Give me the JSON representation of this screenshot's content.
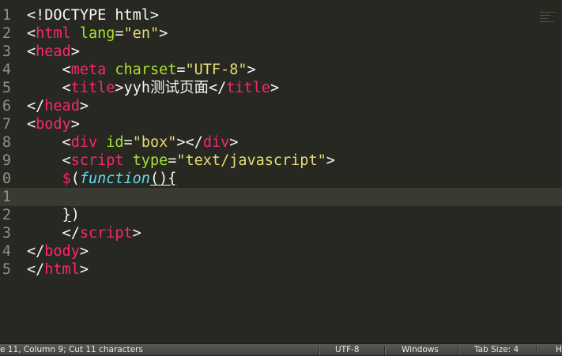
{
  "editor": {
    "line_numbers": [
      "1",
      "2",
      "3",
      "4",
      "5",
      "6",
      "7",
      "8",
      "9",
      "0",
      "1",
      "2",
      "3",
      "4",
      "5"
    ],
    "lines": [
      [
        {
          "t": "<!DOCTYPE html>",
          "c": "plain"
        }
      ],
      [
        {
          "t": "<",
          "c": "plain"
        },
        {
          "t": "html",
          "c": "tag"
        },
        {
          "t": " ",
          "c": "plain"
        },
        {
          "t": "lang",
          "c": "attr"
        },
        {
          "t": "=",
          "c": "plain"
        },
        {
          "t": "\"en\"",
          "c": "str"
        },
        {
          "t": ">",
          "c": "plain"
        }
      ],
      [
        {
          "t": "<",
          "c": "plain"
        },
        {
          "t": "head",
          "c": "tag"
        },
        {
          "t": ">",
          "c": "plain"
        }
      ],
      [
        {
          "t": "    <",
          "c": "plain"
        },
        {
          "t": "meta",
          "c": "tag"
        },
        {
          "t": " ",
          "c": "plain"
        },
        {
          "t": "charset",
          "c": "attr"
        },
        {
          "t": "=",
          "c": "plain"
        },
        {
          "t": "\"UTF-8\"",
          "c": "str"
        },
        {
          "t": ">",
          "c": "plain"
        }
      ],
      [
        {
          "t": "    <",
          "c": "plain"
        },
        {
          "t": "title",
          "c": "tag"
        },
        {
          "t": ">yyh测试页面</",
          "c": "plain"
        },
        {
          "t": "title",
          "c": "tag"
        },
        {
          "t": ">",
          "c": "plain"
        }
      ],
      [
        {
          "t": "</",
          "c": "plain"
        },
        {
          "t": "head",
          "c": "tag"
        },
        {
          "t": ">",
          "c": "plain"
        }
      ],
      [
        {
          "t": "<",
          "c": "plain"
        },
        {
          "t": "body",
          "c": "tag"
        },
        {
          "t": ">",
          "c": "plain"
        }
      ],
      [
        {
          "t": "    <",
          "c": "plain"
        },
        {
          "t": "div",
          "c": "tag"
        },
        {
          "t": " ",
          "c": "plain"
        },
        {
          "t": "id",
          "c": "attr"
        },
        {
          "t": "=",
          "c": "plain"
        },
        {
          "t": "\"box\"",
          "c": "str"
        },
        {
          "t": "></",
          "c": "plain"
        },
        {
          "t": "div",
          "c": "tag"
        },
        {
          "t": ">",
          "c": "plain"
        }
      ],
      [
        {
          "t": "    <",
          "c": "plain"
        },
        {
          "t": "script",
          "c": "tag"
        },
        {
          "t": " ",
          "c": "plain"
        },
        {
          "t": "type",
          "c": "attr"
        },
        {
          "t": "=",
          "c": "plain"
        },
        {
          "t": "\"text/javascript\"",
          "c": "str"
        },
        {
          "t": ">",
          "c": "plain"
        }
      ],
      [
        {
          "t": "    ",
          "c": "plain"
        },
        {
          "t": "$",
          "c": "tag"
        },
        {
          "t": "(",
          "c": "plain"
        },
        {
          "t": "function",
          "c": "kw"
        },
        {
          "t": "(){",
          "c": "plain",
          "u": true
        }
      ],
      [],
      [
        {
          "t": "    ",
          "c": "plain"
        },
        {
          "t": "}",
          "c": "plain",
          "u": true
        },
        {
          "t": ")",
          "c": "plain"
        }
      ],
      [
        {
          "t": "    </",
          "c": "plain"
        },
        {
          "t": "script",
          "c": "tag"
        },
        {
          "t": ">",
          "c": "plain"
        }
      ],
      [
        {
          "t": "</",
          "c": "plain"
        },
        {
          "t": "body",
          "c": "tag"
        },
        {
          "t": ">",
          "c": "plain"
        }
      ],
      [
        {
          "t": "</",
          "c": "plain"
        },
        {
          "t": "html",
          "c": "tag"
        },
        {
          "t": ">",
          "c": "plain"
        }
      ]
    ],
    "active_line_index": 10
  },
  "status": {
    "position": "e 11, Column 9; Cut 11 characters",
    "encoding": "UTF-8",
    "line_endings": "Windows",
    "tab_size": "Tab Size: 4",
    "syntax": "H"
  }
}
